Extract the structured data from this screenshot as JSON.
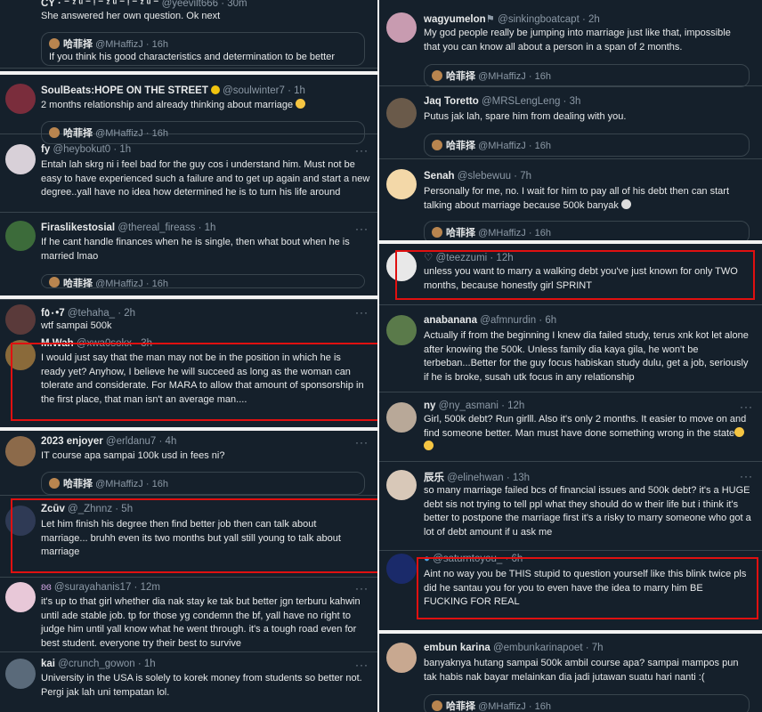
{
  "colors": {
    "bg": "#15202b",
    "text": "#e7e9ea",
    "muted": "#8b98a5",
    "border": "#38444d",
    "highlight": "#e01010"
  },
  "left": [
    {
      "name": "CY · ⁻ ᶻ ᵘ ⁻ ᵎ ⁻ ᶻ ᵘ ⁻ ᵎ ⁻ ᶻ ᵘ ⁻",
      "handle": "@yeevilt666 · 30m",
      "text": "She answered her own question. Ok next",
      "quote": {
        "name": "哈菲择",
        "meta": "@MHaffizJ · 16h",
        "snippet": "If you think his good characteristics and determination to be better"
      }
    },
    {
      "name": "SoulBeats:HOPE ON THE STREET",
      "handle": "@soulwinter7 · 1h",
      "text": "2 months relationship and already thinking about marriage",
      "quote": {
        "name": "哈菲择",
        "meta": "@MHaffizJ · 16h"
      }
    },
    {
      "name": "fy",
      "handle": "@heybokut0 · 1h",
      "text": "Entah lah skrg ni i feel bad for the guy cos i understand him. Must not be easy to have experienced such a failure and to get up again and start a new degree..yall have no idea how determined he is to turn his life around"
    },
    {
      "name": "Firaslikestosial",
      "handle": "@thereal_fireass · 1h",
      "text": "If he cant handle finances when he is single, then what bout when he is married lmao",
      "quote": {
        "name": "哈菲择",
        "meta": "@MHaffizJ · 16h"
      }
    },
    {
      "name": "f٥٠•7",
      "handle": "@tehaha_ · 2h",
      "text": "wtf sampai 500k"
    },
    {
      "name": "M.Wah",
      "handle": "@xwa0sokx · 3h",
      "text": "I would just say that the man may not be in the position in which he is ready yet? Anyhow, I believe he will succeed as long as the woman can tolerate and considerate. For MARA to allow that amount of sponsorship in the first place, that man isn't an average man...."
    },
    {
      "name": "2023 enjoyer",
      "handle": "@erldanu7 · 4h",
      "text": "IT course apa sampai 100k usd in fees ni?",
      "quote": {
        "name": "哈菲择",
        "meta": "@MHaffizJ · 16h"
      }
    },
    {
      "name": "Zcūv",
      "handle": "@_Zhnnz · 5h",
      "text": "Let him finish his degree then find better job then can talk about marriage... bruhh even its two months but yall still young to talk about marriage"
    },
    {
      "name": "",
      "handle": "@surayahanis17 · 12m",
      "text": "it's up to that girl whether dia nak stay ke tak but better jgn terburu kahwin until ade stable job. tp for those yg condemn the bf, yall have no right to judge him until yall know what he went through. it's a tough road even for best student. everyone try their best to survive"
    },
    {
      "name": "kai",
      "handle": "@crunch_gowon · 1h",
      "text": "University in the USA is solely to korek money from students so better not. Pergi jak lah uni tempatan lol."
    }
  ],
  "right": [
    {
      "name": "wagyumelon",
      "handle": "@sinkingboatcapt · 2h",
      "text": "My god people really be jumping into marriage just like that, impossible that you can know all about a person in a span of 2 months.",
      "quote": {
        "name": "哈菲择",
        "meta": "@MHaffizJ · 16h"
      }
    },
    {
      "name": "Jaq Toretto",
      "handle": "@MRSLengLeng · 3h",
      "text": "Putus jak lah, spare him from dealing with you.",
      "quote": {
        "name": "哈菲择",
        "meta": "@MHaffizJ · 16h"
      }
    },
    {
      "name": "Senah",
      "handle": "@slebewuu · 7h",
      "text": "Personally for me, no. I wait for him to pay all of his debt then can start talking about marriage because 500k banyak",
      "quote": {
        "name": "哈菲择",
        "meta": "@MHaffizJ · 16h"
      }
    },
    {
      "name": "",
      "handle": "@teezzumi · 12h",
      "text": "unless you want to marry a walking debt you've just known for only TWO months, because honestly girl SPRINT"
    },
    {
      "name": "anabanana",
      "handle": "@afmnurdin · 6h",
      "text": "Actually if from the beginning I knew dia failed study, terus xnk kot let alone after knowing the 500k. Unless family dia kaya gila, he won't be terbeban...Better for the guy focus habiskan study dulu, get a job, seriously if he is broke, susah utk focus in any relationship"
    },
    {
      "name": "ny",
      "handle": "@ny_asmani · 12h",
      "text": "Girl, 500k debt? Run girlll. Also it's only 2 months. It easier to move on and find someone better. Man must have done something wrong in the state"
    },
    {
      "name": "辰乐",
      "handle": "@elinehwan · 13h",
      "text": "so many marriage failed bcs of financial issues and 500k debt? it's a HUGE debt sis not trying to tell ppl what they should do w their life but i think it's better to postpone the marriage first it's a risky to marry someone who got a lot of debt amount if u ask me"
    },
    {
      "name": "",
      "handle": "@saturntoyou_ · 6h",
      "text": "Aint no way you be THIS stupid to question yourself like this blink twice pls did he santau you for you to even have the idea to marry him BE FUCKING FOR REAL"
    },
    {
      "name": "embun karina",
      "handle": "@embunkarinapoet · 7h",
      "text": "banyaknya hutang sampai 500k ambil course apa? sampai mampos pun tak habis nak bayar melainkan dia jadi jutawan suatu hari nanti :(",
      "quote": {
        "name": "哈菲择",
        "meta": "@MHaffizJ · 16h"
      }
    }
  ]
}
